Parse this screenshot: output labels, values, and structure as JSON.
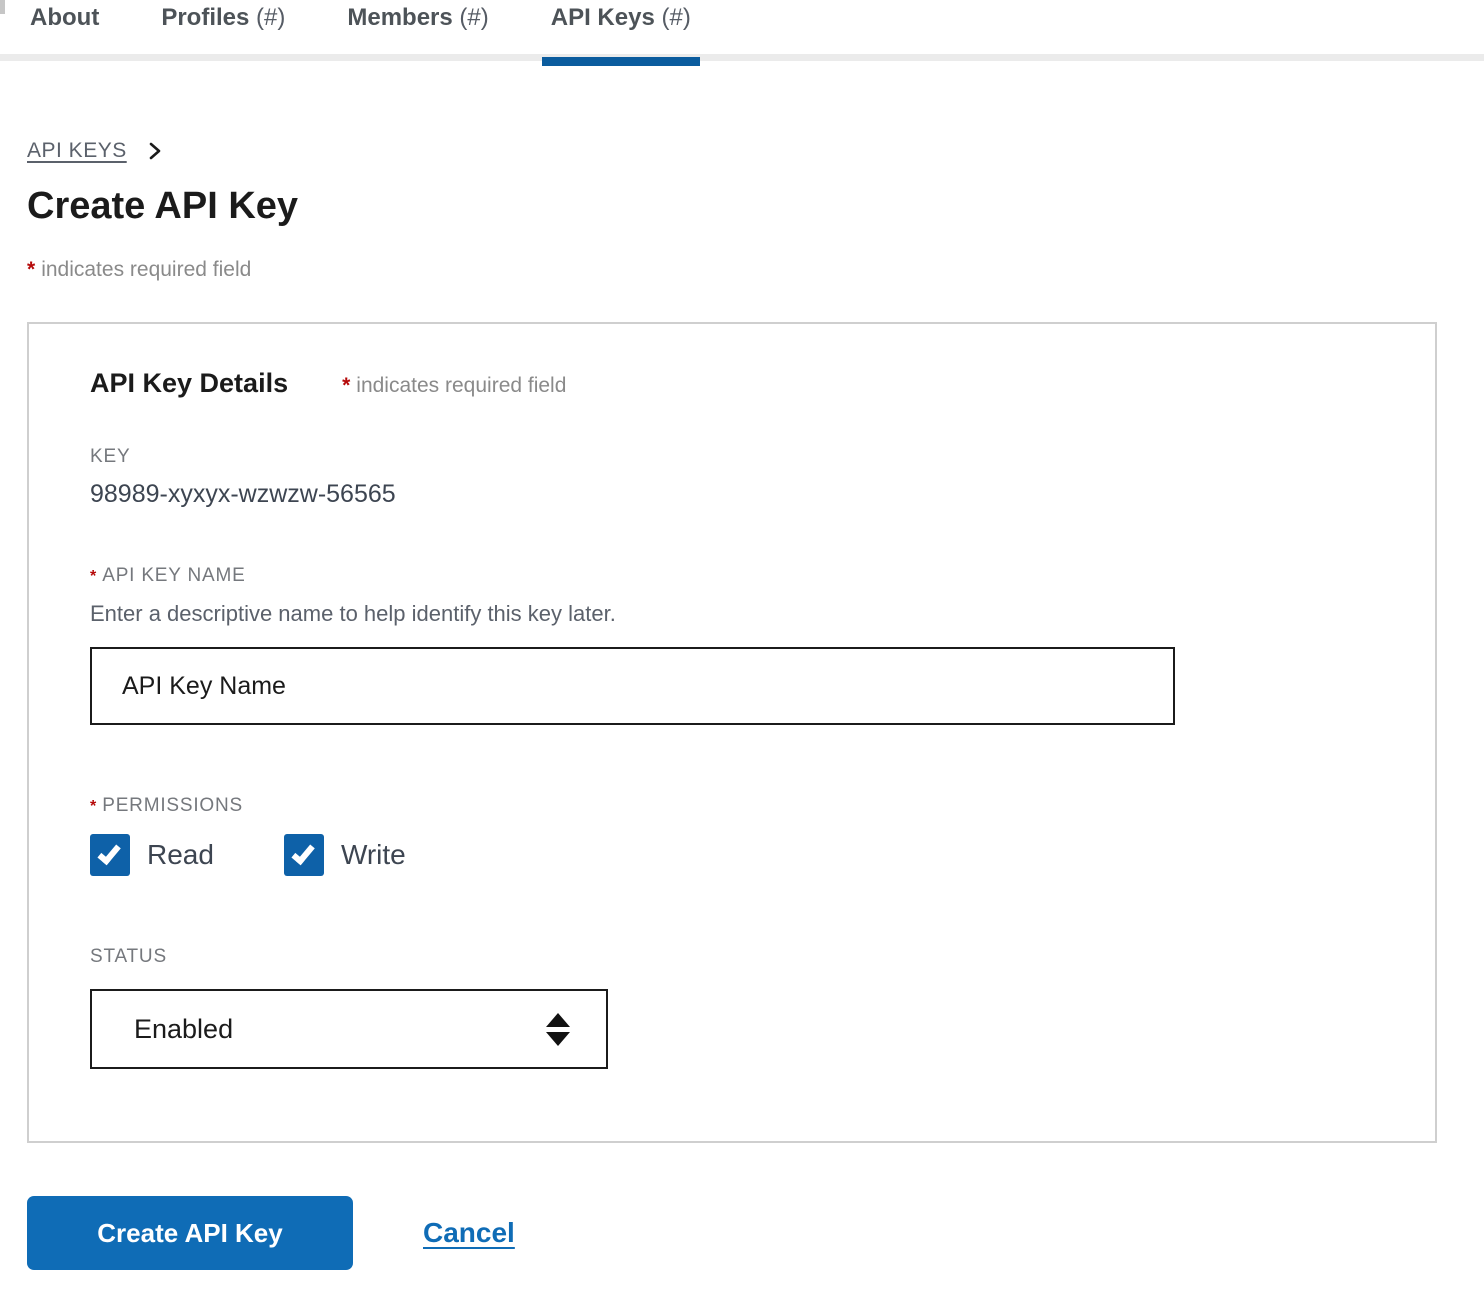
{
  "colors": {
    "primary_blue": "#0f6cb6",
    "tab_underline_blue": "#0b5c9e",
    "checkbox_blue": "#0e61a8",
    "required_red": "#b50909",
    "label_gray": "#75787d",
    "text_dark": "#1b1b1b",
    "border_gray": "#cfcfcf"
  },
  "asterisk": "*",
  "tabs": {
    "items": [
      {
        "name": "About",
        "count": "",
        "active": false
      },
      {
        "name": "Profiles",
        "count": "(#)",
        "active": false
      },
      {
        "name": "Members",
        "count": "(#)",
        "active": false
      },
      {
        "name": "API Keys",
        "count": "(#)",
        "active": true
      }
    ]
  },
  "breadcrumb": {
    "link": "API KEYS"
  },
  "page": {
    "title": "Create API Key",
    "required_note": "indicates required field"
  },
  "panel": {
    "heading": "API Key Details",
    "required_note": "indicates required field",
    "key": {
      "label": "KEY",
      "value": "98989-xyxyx-wzwzw-56565"
    },
    "name_field": {
      "label": "API KEY NAME",
      "required": true,
      "help": "Enter a descriptive name to help identify this key later.",
      "value": "API Key Name"
    },
    "permissions": {
      "label": "PERMISSIONS",
      "required": true,
      "options": [
        {
          "label": "Read",
          "checked": true
        },
        {
          "label": "Write",
          "checked": true
        }
      ]
    },
    "status": {
      "label": "STATUS",
      "value": "Enabled"
    }
  },
  "actions": {
    "submit_label": "Create API Key",
    "cancel_label": "Cancel"
  }
}
